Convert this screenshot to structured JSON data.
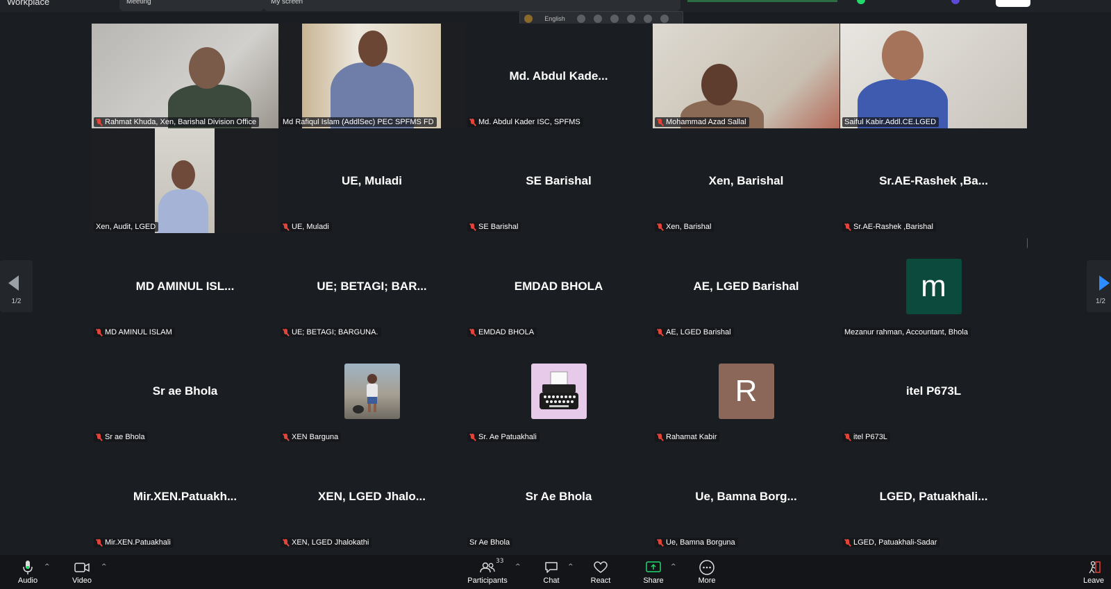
{
  "app": {
    "title": "Workplace",
    "tabs": [
      "Meeting",
      "My screen"
    ]
  },
  "lang_toolbar": {
    "language": "English"
  },
  "tiles": [
    {
      "name": "Rahmat Khuda, Xen, Barishal Division Office",
      "display": "",
      "muted": true,
      "video": true,
      "active": false
    },
    {
      "name": "Md Rafiqul Islam (AddlSec) PEC SPFMS FD",
      "display": "",
      "muted": false,
      "video": true,
      "active": true
    },
    {
      "name": "Md. Abdul Kader ISC, SPFMS",
      "display": "Md. Abdul Kade...",
      "muted": true,
      "video": false,
      "active": false
    },
    {
      "name": "Mohammad Azad Sallal",
      "display": "",
      "muted": true,
      "video": true,
      "active": false
    },
    {
      "name": "Saiful Kabir.Addl.CE.LGED",
      "display": "",
      "muted": false,
      "video": true,
      "active": false
    },
    {
      "name": "Xen, Audit, LGED",
      "display": "",
      "muted": false,
      "video": true,
      "active": false
    },
    {
      "name": "UE, Muladi",
      "display": "UE, Muladi",
      "muted": true,
      "video": false,
      "active": false
    },
    {
      "name": "SE Barishal",
      "display": "SE Barishal",
      "muted": true,
      "video": false,
      "active": false
    },
    {
      "name": "Xen, Barishal",
      "display": "Xen, Barishal",
      "muted": true,
      "video": false,
      "active": false
    },
    {
      "name": "Sr.AE-Rashek ,Barishal",
      "display": "Sr.AE-Rashek ,Ba...",
      "muted": true,
      "video": false,
      "active": false
    },
    {
      "name": "MD AMINUL ISLAM",
      "display": "MD AMINUL ISL...",
      "muted": true,
      "video": false,
      "active": false
    },
    {
      "name": "UE; BETAGI; BARGUNA.",
      "display": "UE; BETAGI; BAR...",
      "muted": true,
      "video": false,
      "active": false
    },
    {
      "name": "EMDAD BHOLA",
      "display": "EMDAD BHOLA",
      "muted": true,
      "video": false,
      "active": false
    },
    {
      "name": "AE, LGED Barishal",
      "display": "AE, LGED Barishal",
      "muted": true,
      "video": false,
      "active": false
    },
    {
      "name": "Mezanur rahman, Accountant, Bhola",
      "display": "",
      "avatar_letter": "m",
      "avatar_color": "#0b4a3c",
      "muted": false,
      "video": false,
      "active": false
    },
    {
      "name": "Sr ae Bhola",
      "display": "Sr ae Bhola",
      "muted": true,
      "video": false,
      "active": false
    },
    {
      "name": "XEN Barguna",
      "display": "",
      "avatar_image": "child-photo",
      "muted": true,
      "video": false,
      "active": false
    },
    {
      "name": "Sr. Ae Patuakhali",
      "display": "",
      "avatar_image": "typewriter",
      "muted": true,
      "video": false,
      "active": false
    },
    {
      "name": "Rahamat Kabir",
      "display": "",
      "avatar_letter": "R",
      "avatar_color": "#8a6758",
      "muted": true,
      "video": false,
      "active": false
    },
    {
      "name": "itel P673L",
      "display": "itel P673L",
      "muted": true,
      "video": false,
      "active": false
    },
    {
      "name": "Mir.XEN.Patuakhali",
      "display": "Mir.XEN.Patuakh...",
      "muted": true,
      "video": false,
      "active": false
    },
    {
      "name": "XEN, LGED Jhalokathi",
      "display": "XEN, LGED Jhalo...",
      "muted": true,
      "video": false,
      "active": false
    },
    {
      "name": "Sr Ae Bhola",
      "display": "Sr Ae Bhola",
      "muted": false,
      "video": false,
      "active": false
    },
    {
      "name": "Ue, Bamna Borguna",
      "display": "Ue, Bamna Borg...",
      "muted": true,
      "video": false,
      "active": false
    },
    {
      "name": "LGED, Patuakhali-Sadar",
      "display": "LGED, Patuakhali...",
      "muted": true,
      "video": false,
      "active": false
    }
  ],
  "pagination": {
    "left": "1/2",
    "right": "1/2"
  },
  "more_chip": "···",
  "toolbar": {
    "audio": "Audio",
    "video": "Video",
    "participants": "Participants",
    "participants_count": "33",
    "chat": "Chat",
    "react": "React",
    "share": "Share",
    "more": "More",
    "leave": "Leave"
  },
  "colors": {
    "active_border": "#23d96c",
    "muted_red": "#e2443a",
    "share_green": "#23d96c",
    "chip_blue": "#1f6fe0"
  }
}
